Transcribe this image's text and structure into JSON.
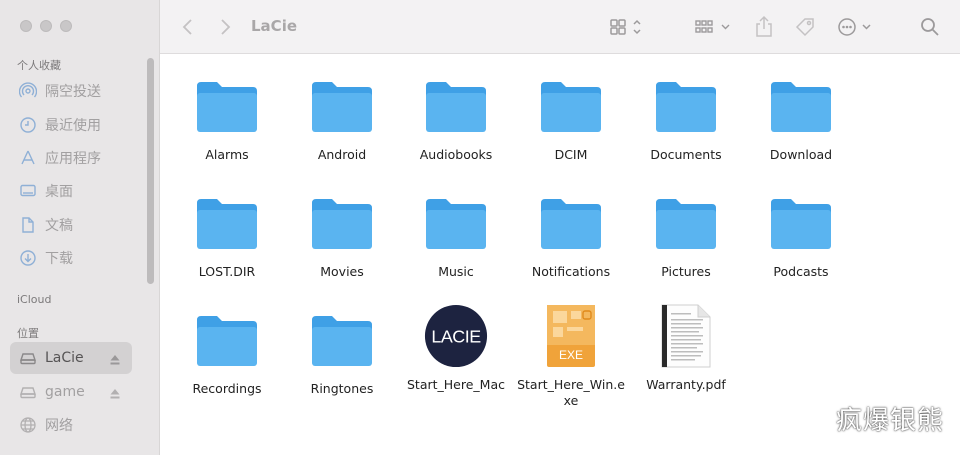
{
  "window": {
    "title": "LaCie"
  },
  "sidebar": {
    "favorites_title": "个人收藏",
    "favorites": [
      {
        "label": "隔空投送",
        "icon": "airdrop-icon"
      },
      {
        "label": "最近使用",
        "icon": "clock-icon"
      },
      {
        "label": "应用程序",
        "icon": "applications-icon"
      },
      {
        "label": "桌面",
        "icon": "desktop-icon"
      },
      {
        "label": "文稿",
        "icon": "document-icon"
      },
      {
        "label": "下载",
        "icon": "download-icon"
      }
    ],
    "icloud_title": "iCloud",
    "locations_title": "位置",
    "locations": [
      {
        "label": "LaCie",
        "icon": "drive-icon",
        "active": true
      },
      {
        "label": "game",
        "icon": "drive-icon",
        "active": false
      },
      {
        "label": "网络",
        "icon": "globe-icon",
        "active": false
      }
    ]
  },
  "files": [
    {
      "name": "Alarms",
      "type": "folder"
    },
    {
      "name": "Android",
      "type": "folder"
    },
    {
      "name": "Audiobooks",
      "type": "folder"
    },
    {
      "name": "DCIM",
      "type": "folder"
    },
    {
      "name": "Documents",
      "type": "folder"
    },
    {
      "name": "Download",
      "type": "folder"
    },
    {
      "name": "LOST.DIR",
      "type": "folder"
    },
    {
      "name": "Movies",
      "type": "folder"
    },
    {
      "name": "Music",
      "type": "folder"
    },
    {
      "name": "Notifications",
      "type": "folder"
    },
    {
      "name": "Pictures",
      "type": "folder"
    },
    {
      "name": "Podcasts",
      "type": "folder"
    },
    {
      "name": "Recordings",
      "type": "folder"
    },
    {
      "name": "Ringtones",
      "type": "folder"
    },
    {
      "name": "Start_Here_Mac",
      "type": "app",
      "badge": "LACIE"
    },
    {
      "name": "Start_Here_Win.exe",
      "type": "exe",
      "badge": "EXE"
    },
    {
      "name": "Warranty.pdf",
      "type": "pdf"
    }
  ],
  "watermark": "疯爆银熊",
  "colors": {
    "folder": "#5ab4f0",
    "folder_tab": "#3fa0e6",
    "sidebar_bg": "#e8e6e7",
    "exe": "#f0a33a"
  }
}
